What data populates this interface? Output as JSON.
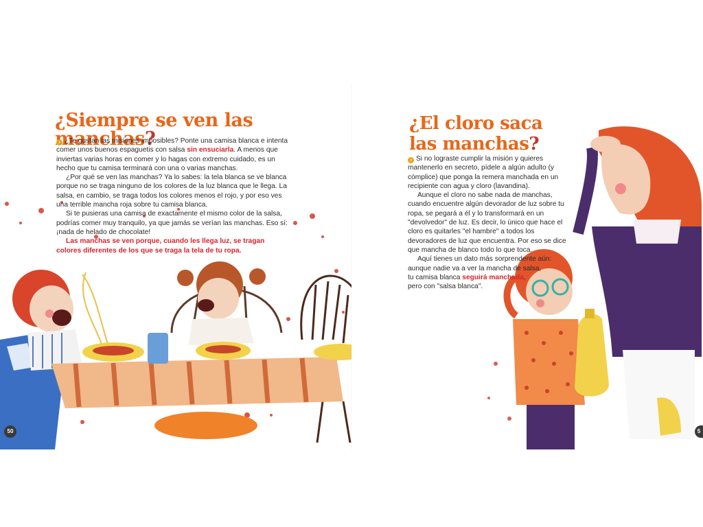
{
  "left_page": {
    "title_prefix": "¿",
    "title_main": "Siempre se ven las manchas",
    "title_suffix": "?",
    "paragraphs": [
      {
        "text_a": "¿Te gustan las misiones imposibles? Ponte una camisa blanca e intenta comer unos buenos espaguetis con salsa ",
        "highlight": "sin ensuciarla",
        "text_b": ". A menos que inviertas varias horas en comer y lo hagas con extremo cuidado, es un hecho que tu camisa terminará con una o varias manchas."
      },
      {
        "text": "¿Por qué se ven las manchas? Ya lo sabes: la tela blanca se ve blanca porque no se traga ninguno de los colores de la luz blanca que le llega. La salsa, en cambio, se traga todos los colores menos el rojo, y por eso ves una terrible mancha roja sobre tu camisa blanca."
      },
      {
        "text": "Si te pusieras una camisa de exactamente el mismo color de la salsa, podrías comer muy tranquilo, ya que jamás se verían las manchas. Eso sí: ¡nada de helado de chocolate!"
      },
      {
        "text": "Las manchas se ven porque, cuando les llega luz, se tragan colores diferentes de los que se traga la tela de tu ropa."
      }
    ],
    "page_number": "50"
  },
  "right_page": {
    "title_line1": "¿El cloro saca",
    "title_line2": "las manchas",
    "title_suffix": "?",
    "paragraphs": [
      {
        "text": "Si no lograste cumplir la misión y quieres mantenerlo en secreto, pídele a algún adulto (y cómplice) que ponga la remera manchada en un recipiente con agua y cloro (lavandina)."
      },
      {
        "text": "Aunque el cloro no sabe nada de manchas, cuando encuentre algún devorador de luz sobre tu ropa, se pegará a él y lo transformará en un \"devolvedor\" de luz. Es decir, lo único que hace el cloro es quitarles \"el hambre\" a todos los devoradores de luz que encuentra. Por eso se dice que mancha de blanco todo lo que toca."
      },
      {
        "text": "Aquí tienes un dato más sorprendente aún:"
      },
      {
        "text": "aunque nadie va a ver la mancha de salsa,"
      },
      {
        "text_a": "tu camisa blanca ",
        "highlight": "seguirá manchada",
        "text_b": ","
      },
      {
        "text": "pero con \"salsa blanca\"."
      }
    ],
    "page_number": "5"
  },
  "colors": {
    "title_orange": "#e8661b",
    "highlight_red": "#d6242d",
    "bullet_orange": "#f0a21a"
  },
  "icons": [
    "bullet-arrow-icon"
  ]
}
